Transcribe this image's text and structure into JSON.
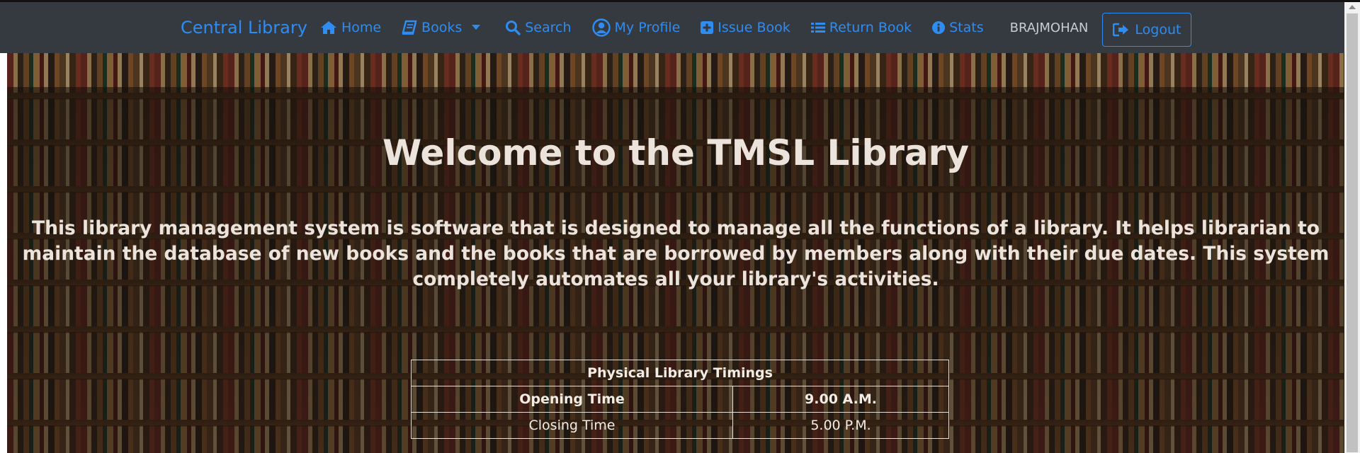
{
  "navbar": {
    "brand": "Central Library",
    "items": [
      {
        "label": "Home",
        "icon": "home-icon"
      },
      {
        "label": "Books",
        "icon": "book-icon"
      },
      {
        "label": "Search",
        "icon": "search-icon"
      },
      {
        "label": "My Profile",
        "icon": "user-circle-icon"
      },
      {
        "label": "Issue Book",
        "icon": "plus-square-icon"
      },
      {
        "label": "Return Book",
        "icon": "list-icon"
      },
      {
        "label": "Stats",
        "icon": "info-circle-icon"
      }
    ],
    "username": "BRAJMOHAN",
    "logout": "Logout",
    "accent_color": "#2f8cf1",
    "background_color": "#343a40"
  },
  "hero": {
    "title": "Welcome to the TMSL Library",
    "description": "This library management system is software that is designed to manage all the functions of a library. It helps librarian to maintain the database of new books and the books that are borrowed by members along with their due dates. This system completely automates all your library's activities."
  },
  "timings": {
    "caption": "Physical Library Timings",
    "rows": [
      {
        "label": "Opening Time",
        "value": "9.00 A.M."
      },
      {
        "label": "Closing Time",
        "value": "5.00 P.M."
      }
    ]
  }
}
